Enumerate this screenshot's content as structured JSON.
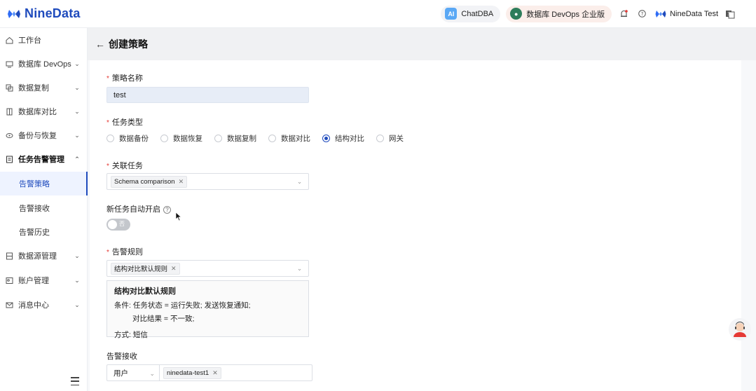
{
  "app": {
    "name": "NineData"
  },
  "topbar": {
    "chatdba_label": "ChatDBA",
    "devops_label": "数据库 DevOps 企业版",
    "user_name": "NineData Test"
  },
  "sidebar": {
    "items": [
      {
        "label": "工作台"
      },
      {
        "label": "数据库 DevOps"
      },
      {
        "label": "数据复制"
      },
      {
        "label": "数据库对比"
      },
      {
        "label": "备份与恢复"
      },
      {
        "label": "任务告警管理"
      },
      {
        "label": "数据源管理"
      },
      {
        "label": "账户管理"
      },
      {
        "label": "消息中心"
      }
    ],
    "sub_items": [
      {
        "label": "告警策略"
      },
      {
        "label": "告警接收"
      },
      {
        "label": "告警历史"
      }
    ]
  },
  "page": {
    "title": "创建策略",
    "strategy_name_label": "策略名称",
    "strategy_name_value": "test",
    "task_type_label": "任务类型",
    "task_types": [
      "数据备份",
      "数据恢复",
      "数据复制",
      "数据对比",
      "结构对比",
      "网关"
    ],
    "selected_task_type": "结构对比",
    "linked_task_label": "关联任务",
    "linked_task_tag": "Schema comparison",
    "auto_enable_label": "新任务自动开启",
    "auto_enable_toggle_text": "否",
    "auto_enable_on": false,
    "alert_rule_label": "告警规则",
    "alert_rule_tag": "结构对比默认规则",
    "rule_box": {
      "title": "结构对比默认规则",
      "line1": "条件: 任务状态 = 运行失败; 发送恢复通知;",
      "line2": "对比结果 = 不一致;",
      "line3": "方式: 短信"
    },
    "receiver_label": "告警接收",
    "receiver_type": "用户",
    "receiver_tag": "ninedata-test1"
  }
}
